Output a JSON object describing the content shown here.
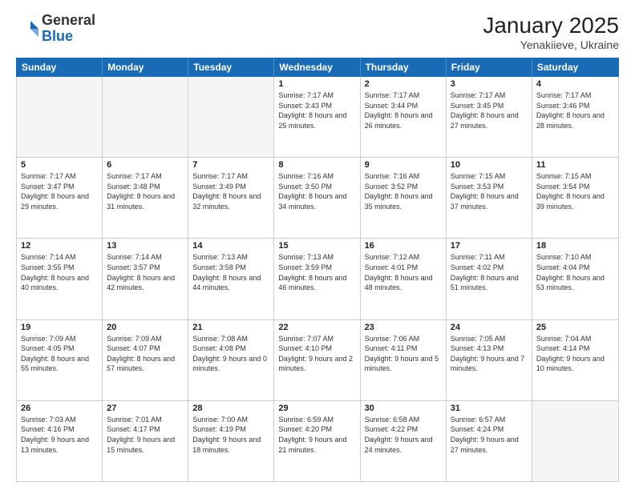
{
  "logo": {
    "general": "General",
    "blue": "Blue"
  },
  "title": "January 2025",
  "subtitle": "Yenakiieve, Ukraine",
  "days": [
    "Sunday",
    "Monday",
    "Tuesday",
    "Wednesday",
    "Thursday",
    "Friday",
    "Saturday"
  ],
  "weeks": [
    [
      {
        "day": "",
        "empty": true
      },
      {
        "day": "",
        "empty": true
      },
      {
        "day": "",
        "empty": true
      },
      {
        "day": "1",
        "sunrise": "7:17 AM",
        "sunset": "3:43 PM",
        "daylight": "8 hours and 25 minutes."
      },
      {
        "day": "2",
        "sunrise": "7:17 AM",
        "sunset": "3:44 PM",
        "daylight": "8 hours and 26 minutes."
      },
      {
        "day": "3",
        "sunrise": "7:17 AM",
        "sunset": "3:45 PM",
        "daylight": "8 hours and 27 minutes."
      },
      {
        "day": "4",
        "sunrise": "7:17 AM",
        "sunset": "3:46 PM",
        "daylight": "8 hours and 28 minutes."
      }
    ],
    [
      {
        "day": "5",
        "sunrise": "7:17 AM",
        "sunset": "3:47 PM",
        "daylight": "8 hours and 29 minutes."
      },
      {
        "day": "6",
        "sunrise": "7:17 AM",
        "sunset": "3:48 PM",
        "daylight": "8 hours and 31 minutes."
      },
      {
        "day": "7",
        "sunrise": "7:17 AM",
        "sunset": "3:49 PM",
        "daylight": "8 hours and 32 minutes."
      },
      {
        "day": "8",
        "sunrise": "7:16 AM",
        "sunset": "3:50 PM",
        "daylight": "8 hours and 34 minutes."
      },
      {
        "day": "9",
        "sunrise": "7:16 AM",
        "sunset": "3:52 PM",
        "daylight": "8 hours and 35 minutes."
      },
      {
        "day": "10",
        "sunrise": "7:15 AM",
        "sunset": "3:53 PM",
        "daylight": "8 hours and 37 minutes."
      },
      {
        "day": "11",
        "sunrise": "7:15 AM",
        "sunset": "3:54 PM",
        "daylight": "8 hours and 39 minutes."
      }
    ],
    [
      {
        "day": "12",
        "sunrise": "7:14 AM",
        "sunset": "3:55 PM",
        "daylight": "8 hours and 40 minutes."
      },
      {
        "day": "13",
        "sunrise": "7:14 AM",
        "sunset": "3:57 PM",
        "daylight": "8 hours and 42 minutes."
      },
      {
        "day": "14",
        "sunrise": "7:13 AM",
        "sunset": "3:58 PM",
        "daylight": "8 hours and 44 minutes."
      },
      {
        "day": "15",
        "sunrise": "7:13 AM",
        "sunset": "3:59 PM",
        "daylight": "8 hours and 46 minutes."
      },
      {
        "day": "16",
        "sunrise": "7:12 AM",
        "sunset": "4:01 PM",
        "daylight": "8 hours and 48 minutes."
      },
      {
        "day": "17",
        "sunrise": "7:11 AM",
        "sunset": "4:02 PM",
        "daylight": "8 hours and 51 minutes."
      },
      {
        "day": "18",
        "sunrise": "7:10 AM",
        "sunset": "4:04 PM",
        "daylight": "8 hours and 53 minutes."
      }
    ],
    [
      {
        "day": "19",
        "sunrise": "7:09 AM",
        "sunset": "4:05 PM",
        "daylight": "8 hours and 55 minutes."
      },
      {
        "day": "20",
        "sunrise": "7:09 AM",
        "sunset": "4:07 PM",
        "daylight": "8 hours and 57 minutes."
      },
      {
        "day": "21",
        "sunrise": "7:08 AM",
        "sunset": "4:08 PM",
        "daylight": "9 hours and 0 minutes."
      },
      {
        "day": "22",
        "sunrise": "7:07 AM",
        "sunset": "4:10 PM",
        "daylight": "9 hours and 2 minutes."
      },
      {
        "day": "23",
        "sunrise": "7:06 AM",
        "sunset": "4:11 PM",
        "daylight": "9 hours and 5 minutes."
      },
      {
        "day": "24",
        "sunrise": "7:05 AM",
        "sunset": "4:13 PM",
        "daylight": "9 hours and 7 minutes."
      },
      {
        "day": "25",
        "sunrise": "7:04 AM",
        "sunset": "4:14 PM",
        "daylight": "9 hours and 10 minutes."
      }
    ],
    [
      {
        "day": "26",
        "sunrise": "7:03 AM",
        "sunset": "4:16 PM",
        "daylight": "9 hours and 13 minutes."
      },
      {
        "day": "27",
        "sunrise": "7:01 AM",
        "sunset": "4:17 PM",
        "daylight": "9 hours and 15 minutes."
      },
      {
        "day": "28",
        "sunrise": "7:00 AM",
        "sunset": "4:19 PM",
        "daylight": "9 hours and 18 minutes."
      },
      {
        "day": "29",
        "sunrise": "6:59 AM",
        "sunset": "4:20 PM",
        "daylight": "9 hours and 21 minutes."
      },
      {
        "day": "30",
        "sunrise": "6:58 AM",
        "sunset": "4:22 PM",
        "daylight": "9 hours and 24 minutes."
      },
      {
        "day": "31",
        "sunrise": "6:57 AM",
        "sunset": "4:24 PM",
        "daylight": "9 hours and 27 minutes."
      },
      {
        "day": "",
        "empty": true
      }
    ]
  ]
}
